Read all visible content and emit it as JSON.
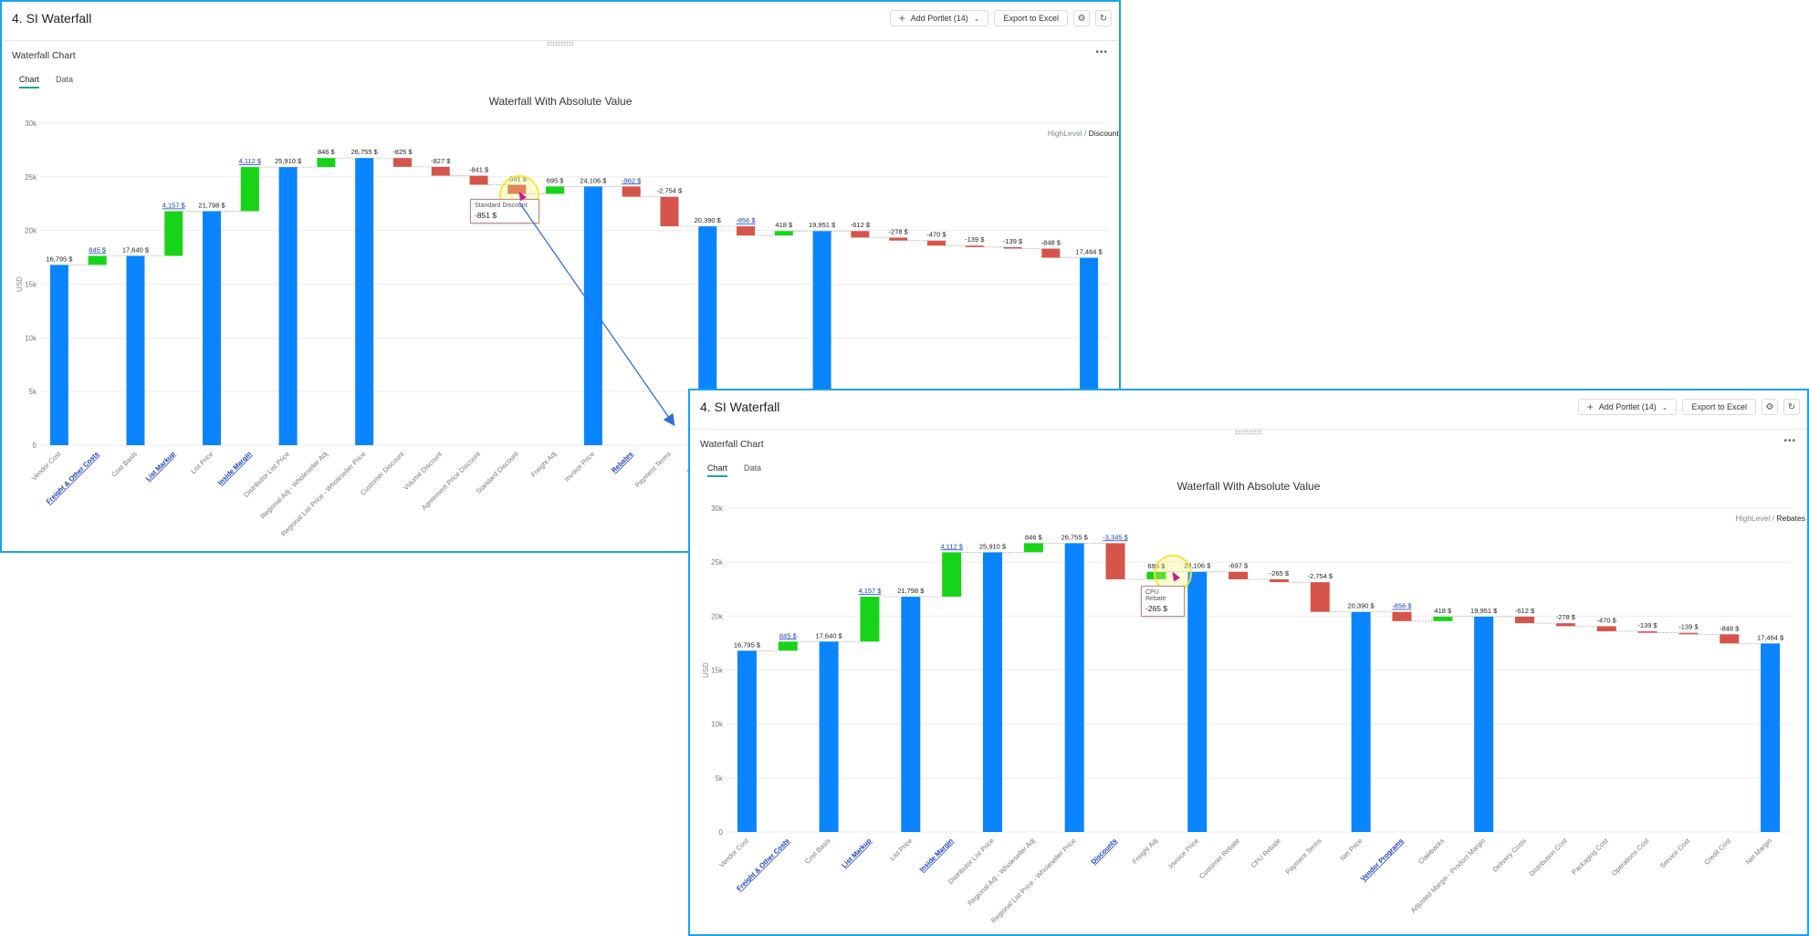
{
  "app": {
    "title": "4. SI Waterfall",
    "add_portlet": "Add Portlet (14)",
    "export": "Export to Excel",
    "portlet_title": "Waterfall Chart",
    "tabs": [
      "Chart",
      "Data"
    ]
  },
  "colors": {
    "base": "#0a84ff",
    "increase": "#18d418",
    "decrease": "#d6554b",
    "frame": "#1aa3e8"
  },
  "icons": {
    "add": "plus-icon",
    "dropdown": "chevron-down-icon",
    "settings": "gear-icon",
    "refresh": "refresh-icon",
    "menu": "more-horizontal-icon"
  },
  "chart_data": [
    {
      "type": "waterfall",
      "title": "Waterfall With Absolute Value",
      "ylabel": "USD",
      "ylim": [
        0,
        30000
      ],
      "yticks": [
        "0",
        "5k",
        "10k",
        "15k",
        "20k",
        "25k",
        "30k"
      ],
      "breadcrumb": [
        "HighLevel",
        "Discounts"
      ],
      "categories": [
        "Vendor Cost",
        "Freight & Other Costs",
        "Cost Basis",
        "List Markup",
        "List Price",
        "Inside Margin",
        "Distributor List Price",
        "Regional Adj - Wholeseller Adj",
        "Regional List Price - Wholeseller Price",
        "Customer Discount",
        "Volume Discount",
        "Agreement Price Discount",
        "Standard Discount",
        "Freight Adj",
        "Invoice Price",
        "Rebates",
        "Payment Terms",
        "Net Price",
        "Vendor Programs",
        "Clawbacks",
        "Adjusted Margin - Product Margin",
        "Delivery Costs",
        "Distribution Cost",
        "Packaging Cost",
        "Operations Cost",
        "Service Cost",
        "Credit Cost",
        "Net Margin"
      ],
      "kinds": [
        "total",
        "delta",
        "total",
        "delta",
        "total",
        "delta",
        "total",
        "delta",
        "total",
        "delta",
        "delta",
        "delta",
        "delta",
        "delta",
        "total",
        "delta",
        "delta",
        "total",
        "delta",
        "delta",
        "total",
        "delta",
        "delta",
        "delta",
        "delta",
        "delta",
        "delta",
        "total"
      ],
      "values": [
        16795,
        845,
        17640,
        4157,
        21798,
        4112,
        25910,
        846,
        26755,
        -825,
        -827,
        -841,
        -851,
        695,
        24106,
        -962,
        -2754,
        20390,
        -856,
        418,
        19951,
        -612,
        -278,
        -470,
        -139,
        -139,
        -848,
        17464
      ],
      "labels": [
        "16,795 $",
        "845 $",
        "17,640 $",
        "4,157 $",
        "21,798 $",
        "4,112 $",
        "25,910 $",
        "846 $",
        "26,755 $",
        "-825 $",
        "-827 $",
        "-841 $",
        "-851 $",
        "695 $",
        "24,106 $",
        "-962 $",
        "-2,754 $",
        "20,390 $",
        "-856 $",
        "418 $",
        "19,951 $",
        "-612 $",
        "-278 $",
        "-470 $",
        "-139 $",
        "-139 $",
        "-848 $",
        "17,464 $"
      ],
      "drilldown": [
        "Freight & Other Costs",
        "List Markup",
        "Inside Margin",
        "Rebates",
        "Vendor Programs"
      ],
      "tooltip": {
        "name": "Standard Discount",
        "value": "-851 $"
      }
    },
    {
      "type": "waterfall",
      "title": "Waterfall With Absolute Value",
      "ylabel": "USD",
      "ylim": [
        0,
        30000
      ],
      "yticks": [
        "0",
        "5k",
        "10k",
        "15k",
        "20k",
        "25k",
        "30k"
      ],
      "breadcrumb": [
        "HighLevel",
        "Rebates"
      ],
      "categories": [
        "Vendor Cost",
        "Freight & Other Costs",
        "Cost Basis",
        "List Markup",
        "List Price",
        "Inside Margin",
        "Distributor List Price",
        "Regional Adj - Wholeseller Adj",
        "Regional List Price - Wholeseller Price",
        "Discounts",
        "Freight Adj",
        "Invoice Price",
        "Customer Rebate",
        "CPU Rebate",
        "Payment Terms",
        "Net Price",
        "Vendor Programs",
        "Clawbacks",
        "Adjusted Margin - Product Margin",
        "Delivery Costs",
        "Distribution Cost",
        "Packaging Cost",
        "Operations Cost",
        "Service Cost",
        "Credit Cost",
        "Net Margin"
      ],
      "kinds": [
        "total",
        "delta",
        "total",
        "delta",
        "total",
        "delta",
        "total",
        "delta",
        "total",
        "delta",
        "delta",
        "total",
        "delta",
        "delta",
        "delta",
        "total",
        "delta",
        "delta",
        "total",
        "delta",
        "delta",
        "delta",
        "delta",
        "delta",
        "delta",
        "total"
      ],
      "values": [
        16795,
        845,
        17640,
        4157,
        21798,
        4112,
        25910,
        846,
        26755,
        -3345,
        695,
        24106,
        -697,
        -265,
        -2754,
        20390,
        -856,
        418,
        19951,
        -612,
        -278,
        -470,
        -139,
        -139,
        -848,
        17464
      ],
      "labels": [
        "16,795 $",
        "845 $",
        "17,640 $",
        "4,157 $",
        "21,798 $",
        "4,112 $",
        "25,910 $",
        "846 $",
        "26,755 $",
        "-3,345 $",
        "695 $",
        "24,106 $",
        "-697 $",
        "-265 $",
        "-2,754 $",
        "20,390 $",
        "-856 $",
        "418 $",
        "19,951 $",
        "-612 $",
        "-278 $",
        "-470 $",
        "-139 $",
        "-139 $",
        "-848 $",
        "17,464 $"
      ],
      "drilldown": [
        "Freight & Other Costs",
        "List Markup",
        "Inside Margin",
        "Discounts",
        "Vendor Programs"
      ],
      "tooltip": {
        "name": "CPU Rebate",
        "value": "-265 $"
      }
    }
  ]
}
